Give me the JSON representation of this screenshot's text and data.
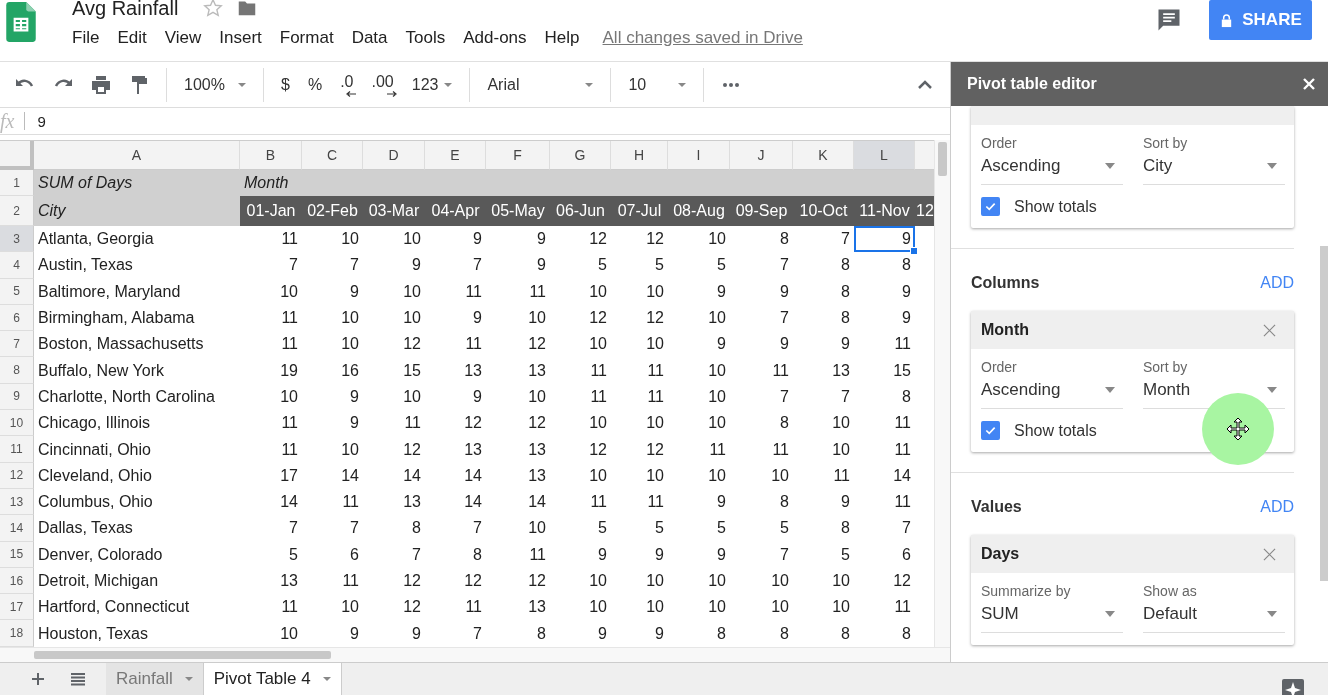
{
  "document": {
    "title": "Avg Rainfall",
    "save_status": "All changes saved in Drive"
  },
  "menu": [
    "File",
    "Edit",
    "View",
    "Insert",
    "Format",
    "Data",
    "Tools",
    "Add-ons",
    "Help"
  ],
  "share_button": "SHARE",
  "toolbar": {
    "zoom": "100%",
    "currency": "$",
    "percent": "%",
    "decrease_decimals": ".0",
    "increase_decimals": ".00",
    "more_formats": "123",
    "font": "Arial",
    "font_size": "10"
  },
  "formula_bar": {
    "label": "fx",
    "value": "9"
  },
  "sheet": {
    "columns": [
      {
        "label": "A",
        "selected": false
      },
      {
        "label": "B",
        "selected": false
      },
      {
        "label": "C",
        "selected": false
      },
      {
        "label": "D",
        "selected": false
      },
      {
        "label": "E",
        "selected": false
      },
      {
        "label": "F",
        "selected": false
      },
      {
        "label": "G",
        "selected": false
      },
      {
        "label": "H",
        "selected": false
      },
      {
        "label": "I",
        "selected": false
      },
      {
        "label": "J",
        "selected": false
      },
      {
        "label": "K",
        "selected": false
      },
      {
        "label": "L",
        "selected": true
      }
    ],
    "title_row": {
      "number": "1",
      "row_label": "SUM of Days",
      "column_label": "Month"
    },
    "header_row": {
      "number": "2",
      "row_label": "City",
      "months": [
        "01-Jan",
        "02-Feb",
        "03-Mar",
        "04-Apr",
        "05-May",
        "06-Jun",
        "07-Jul",
        "08-Aug",
        "09-Sep",
        "10-Oct",
        "11-Nov",
        "12"
      ]
    },
    "rows": [
      {
        "number": "3",
        "city": "Atlanta, Georgia",
        "values": [
          "11",
          "10",
          "10",
          "9",
          "9",
          "12",
          "12",
          "10",
          "8",
          "7",
          "9"
        ],
        "selected": true
      },
      {
        "number": "4",
        "city": "Austin, Texas",
        "values": [
          "7",
          "7",
          "9",
          "7",
          "9",
          "5",
          "5",
          "5",
          "7",
          "8",
          "8"
        ],
        "selected": false
      },
      {
        "number": "5",
        "city": "Baltimore, Maryland",
        "values": [
          "10",
          "9",
          "10",
          "11",
          "11",
          "10",
          "10",
          "9",
          "9",
          "8",
          "9"
        ],
        "selected": false
      },
      {
        "number": "6",
        "city": "Birmingham, Alabama",
        "values": [
          "11",
          "10",
          "10",
          "9",
          "10",
          "12",
          "12",
          "10",
          "7",
          "8",
          "9"
        ],
        "selected": false
      },
      {
        "number": "7",
        "city": "Boston, Massachusetts",
        "values": [
          "11",
          "10",
          "12",
          "11",
          "12",
          "10",
          "10",
          "9",
          "9",
          "9",
          "11"
        ],
        "selected": false
      },
      {
        "number": "8",
        "city": "Buffalo, New York",
        "values": [
          "19",
          "16",
          "15",
          "13",
          "13",
          "11",
          "11",
          "10",
          "11",
          "13",
          "15"
        ],
        "selected": false
      },
      {
        "number": "9",
        "city": "Charlotte, North Carolina",
        "values": [
          "10",
          "9",
          "10",
          "9",
          "10",
          "11",
          "11",
          "10",
          "7",
          "7",
          "8"
        ],
        "selected": false
      },
      {
        "number": "10",
        "city": "Chicago, Illinois",
        "values": [
          "11",
          "9",
          "11",
          "12",
          "12",
          "10",
          "10",
          "10",
          "8",
          "10",
          "11"
        ],
        "selected": false
      },
      {
        "number": "11",
        "city": "Cincinnati, Ohio",
        "values": [
          "11",
          "10",
          "12",
          "13",
          "13",
          "12",
          "12",
          "11",
          "11",
          "10",
          "11"
        ],
        "selected": false
      },
      {
        "number": "12",
        "city": "Cleveland, Ohio",
        "values": [
          "17",
          "14",
          "14",
          "14",
          "13",
          "10",
          "10",
          "10",
          "10",
          "11",
          "14"
        ],
        "selected": false
      },
      {
        "number": "13",
        "city": "Columbus, Ohio",
        "values": [
          "14",
          "11",
          "13",
          "14",
          "14",
          "11",
          "11",
          "9",
          "8",
          "9",
          "11"
        ],
        "selected": false
      },
      {
        "number": "14",
        "city": "Dallas, Texas",
        "values": [
          "7",
          "7",
          "8",
          "7",
          "10",
          "5",
          "5",
          "5",
          "5",
          "8",
          "7"
        ],
        "selected": false
      },
      {
        "number": "15",
        "city": "Denver, Colorado",
        "values": [
          "5",
          "6",
          "7",
          "8",
          "11",
          "9",
          "9",
          "9",
          "7",
          "5",
          "6"
        ],
        "selected": false
      },
      {
        "number": "16",
        "city": "Detroit, Michigan",
        "values": [
          "13",
          "11",
          "12",
          "12",
          "12",
          "10",
          "10",
          "10",
          "10",
          "10",
          "12"
        ],
        "selected": false
      },
      {
        "number": "17",
        "city": "Hartford, Connecticut",
        "values": [
          "11",
          "10",
          "12",
          "11",
          "13",
          "10",
          "10",
          "10",
          "10",
          "10",
          "11"
        ],
        "selected": false
      },
      {
        "number": "18",
        "city": "Houston, Texas",
        "values": [
          "10",
          "9",
          "9",
          "7",
          "8",
          "9",
          "9",
          "8",
          "8",
          "8",
          "8"
        ],
        "selected": false
      }
    ]
  },
  "sheet_tabs": [
    {
      "label": "Rainfall",
      "selected": false
    },
    {
      "label": "Pivot Table 4",
      "selected": true
    }
  ],
  "pivot_editor": {
    "title": "Pivot table editor",
    "sections": [
      {
        "cards": [
          {
            "fields": [
              {
                "label": "Order",
                "value": "Ascending"
              },
              {
                "label": "Sort by",
                "value": "City"
              }
            ],
            "show_totals": {
              "label": "Show totals",
              "checked": true
            }
          }
        ]
      },
      {
        "heading": "Columns",
        "add_label": "ADD",
        "cards": [
          {
            "title": "Month",
            "fields": [
              {
                "label": "Order",
                "value": "Ascending"
              },
              {
                "label": "Sort by",
                "value": "Month"
              }
            ],
            "show_totals": {
              "label": "Show totals",
              "checked": true
            }
          }
        ]
      },
      {
        "heading": "Values",
        "add_label": "ADD",
        "cards": [
          {
            "title": "Days",
            "fields": [
              {
                "label": "Summarize by",
                "value": "SUM"
              },
              {
                "label": "Show as",
                "value": "Default"
              }
            ]
          }
        ]
      }
    ]
  }
}
